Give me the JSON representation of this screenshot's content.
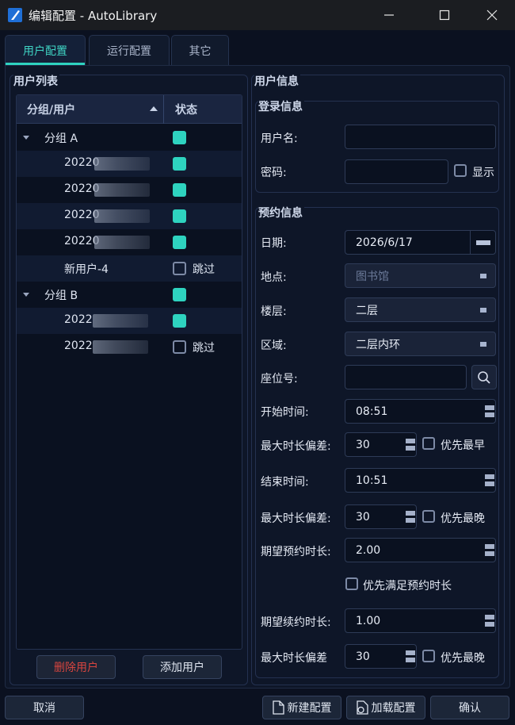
{
  "window": {
    "title": "编辑配置 - AutoLibrary",
    "minimize": "—",
    "close": "✕"
  },
  "tabs": [
    {
      "label": "用户配置",
      "active": true
    },
    {
      "label": "运行配置",
      "active": false
    },
    {
      "label": "其它",
      "active": false
    }
  ],
  "user_list": {
    "title": "用户列表",
    "col_user": "分组/用户",
    "col_status": "状态",
    "rows": [
      {
        "name": "分组 A",
        "group": true,
        "enabled": true,
        "status_text": ""
      },
      {
        "name": "20220",
        "group": false,
        "enabled": true,
        "status_text": ""
      },
      {
        "name": "20220",
        "group": false,
        "enabled": true,
        "status_text": ""
      },
      {
        "name": "20220",
        "group": false,
        "enabled": true,
        "status_text": ""
      },
      {
        "name": "20220",
        "group": false,
        "enabled": true,
        "status_text": ""
      },
      {
        "name": "新用户-4",
        "group": false,
        "enabled": false,
        "status_text": "跳过"
      },
      {
        "name": "分组 B",
        "group": true,
        "enabled": true,
        "status_text": ""
      },
      {
        "name": "2022",
        "group": false,
        "enabled": true,
        "status_text": ""
      },
      {
        "name": "2022",
        "group": false,
        "enabled": false,
        "status_text": "跳过"
      }
    ],
    "delete_button": "删除用户",
    "add_button": "添加用户"
  },
  "user_info": {
    "title": "用户信息",
    "login": {
      "title": "登录信息",
      "username_label": "用户名:",
      "username_value": "",
      "password_label": "密码:",
      "password_value": "",
      "show_label": "显示"
    },
    "reserve": {
      "title": "预约信息",
      "date_label": "日期:",
      "date_value": "2026/6/17",
      "place_label": "地点:",
      "place_value": "图书馆",
      "floor_label": "楼层:",
      "floor_value": "二层",
      "area_label": "区域:",
      "area_value": "二层内环",
      "seat_label": "座位号:",
      "seat_value": "",
      "start_label": "开始时间:",
      "start_value": "08:51",
      "max_dev1_label": "最大时长偏差:",
      "max_dev1_value": "30",
      "earliest_label": "优先最早",
      "end_label": "结束时间:",
      "end_value": "10:51",
      "max_dev2_label": "最大时长偏差:",
      "max_dev2_value": "30",
      "latest_label": "优先最晚",
      "expect_label": "期望预约时长:",
      "expect_value": "2.00",
      "satisfy_label": "优先满足预约时长",
      "renew_label": "期望续约时长:",
      "renew_value": "1.00",
      "max_dev3_label": "最大时长偏差",
      "max_dev3_value": "30",
      "latest2_label": "优先最晚"
    }
  },
  "footer": {
    "cancel": "取消",
    "new_config": "新建配置",
    "load_config": "加载配置",
    "confirm": "确认"
  }
}
